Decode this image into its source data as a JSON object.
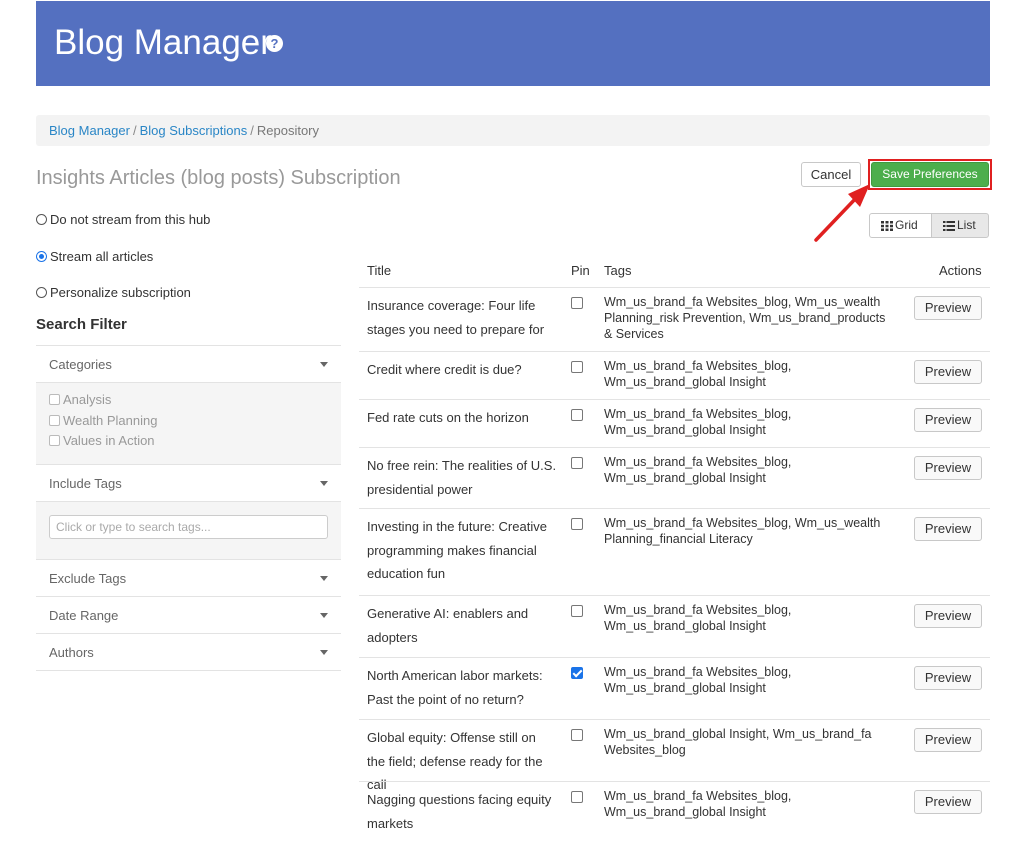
{
  "header": {
    "title": "Blog Manager",
    "help_icon": "question-circle-icon"
  },
  "breadcrumb": {
    "items": [
      "Blog Manager",
      "Blog Subscriptions"
    ],
    "current": "Repository",
    "separator": "/"
  },
  "page": {
    "title": "Insights Articles (blog posts) Subscription"
  },
  "toolbar": {
    "cancel_label": "Cancel",
    "save_label": "Save Preferences",
    "save_color": "#4cae4c",
    "highlight_color": "#e02020"
  },
  "view_toggle": {
    "grid_label": "Grid",
    "list_label": "List",
    "selected": "List"
  },
  "stream_options": [
    {
      "label": "Do not stream from this hub",
      "checked": false
    },
    {
      "label": "Stream all articles",
      "checked": true
    },
    {
      "label": "Personalize subscription",
      "checked": false
    }
  ],
  "search_filter": {
    "title": "Search Filter",
    "categories_label": "Categories",
    "categories": [
      "Analysis",
      "Wealth Planning",
      "Values in Action"
    ],
    "include_tags_label": "Include Tags",
    "include_tags_placeholder": "Click or type to search tags...",
    "exclude_tags_label": "Exclude Tags",
    "date_range_label": "Date Range",
    "authors_label": "Authors"
  },
  "table": {
    "headers": {
      "title": "Title",
      "pin": "Pin",
      "tags": "Tags",
      "actions": "Actions"
    },
    "preview_label": "Preview",
    "rows": [
      {
        "title": "Insurance coverage: Four life stages you need to prepare for",
        "pinned": false,
        "tags": "Wm_us_brand_fa Websites_blog, Wm_us_wealth Planning_risk Prevention, Wm_us_brand_products & Services"
      },
      {
        "title": "Credit where credit is due?",
        "pinned": false,
        "tags": "Wm_us_brand_fa Websites_blog, Wm_us_brand_global Insight"
      },
      {
        "title": "Fed rate cuts on the horizon",
        "pinned": false,
        "tags": "Wm_us_brand_fa Websites_blog, Wm_us_brand_global Insight"
      },
      {
        "title": "No free rein: The realities of U.S. presidential power",
        "pinned": false,
        "tags": "Wm_us_brand_fa Websites_blog, Wm_us_brand_global Insight"
      },
      {
        "title": "Investing in the future: Creative programming makes financial education fun",
        "pinned": false,
        "tags": "Wm_us_brand_fa Websites_blog, Wm_us_wealth Planning_financial Literacy"
      },
      {
        "title": "Generative AI: enablers and adopters",
        "pinned": false,
        "tags": "Wm_us_brand_fa Websites_blog, Wm_us_brand_global Insight"
      },
      {
        "title": "North American labor markets: Past the point of no return?",
        "pinned": true,
        "tags": "Wm_us_brand_fa Websites_blog, Wm_us_brand_global Insight"
      },
      {
        "title": "Global equity: Offense still on the field; defense ready for the call",
        "pinned": false,
        "tags": "Wm_us_brand_global Insight, Wm_us_brand_fa Websites_blog"
      },
      {
        "title": "Nagging questions facing equity markets",
        "pinned": false,
        "tags": "Wm_us_brand_fa Websites_blog, Wm_us_brand_global Insight"
      }
    ]
  }
}
